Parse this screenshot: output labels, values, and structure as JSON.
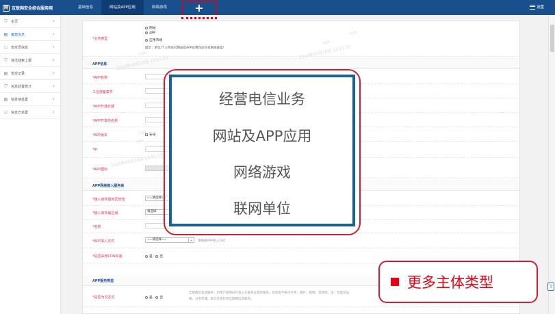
{
  "header": {
    "brand": "互联网安全综合服务网",
    "brand_logo": "网",
    "tabs": [
      {
        "label": "基础信息",
        "active": false
      },
      {
        "label": "网站及APP应用",
        "active": true
      },
      {
        "label": "网络游戏",
        "active": false
      }
    ],
    "plus_label": "+",
    "settings_label": "设置"
  },
  "sidebar": {
    "items": [
      {
        "label": "主页",
        "icon": "shield-icon",
        "glyph": "⛉",
        "active": false
      },
      {
        "label": "备案信息",
        "icon": "document-icon",
        "glyph": "▤",
        "active": true
      },
      {
        "label": "安全员信息",
        "icon": "monitor-icon",
        "glyph": "▭",
        "active": false
      },
      {
        "label": "违法线索上报",
        "icon": "shield-icon",
        "glyph": "⛉",
        "active": false
      },
      {
        "label": "安全记录",
        "icon": "document-icon",
        "glyph": "▤",
        "active": false
      },
      {
        "label": "信息处置统计",
        "icon": "shield-icon",
        "glyph": "⛉",
        "active": false
      },
      {
        "label": "信息待处置",
        "icon": "document-icon",
        "glyph": "▤",
        "active": false
      },
      {
        "label": "信息已处置",
        "icon": "monitor-icon",
        "glyph": "▭",
        "active": false
      }
    ]
  },
  "form": {
    "business_type": {
      "label": "*业务类型",
      "options": [
        "网站",
        "APP",
        "应用市场"
      ],
      "selected": "APP",
      "hint": "提示：单位/个人所有的网站及APP应用均应在本系统备案！"
    },
    "sections": {
      "app_info": "APP信息",
      "network_access": "APP网络接入服务商",
      "app_service": "APP服务类型"
    },
    "fields": {
      "app_name": "*APP名称",
      "icp_no": "工信部备案号",
      "open_date": "*APP开通日期",
      "developer": "*APP开发商名称",
      "version": "*APP版本",
      "version_option": "安卓",
      "ip": "*IP",
      "icon": "*APP图标",
      "provider_region": "*接入商所属地区管辖",
      "provider_region_value": "==请选择==",
      "provider_area": "*接入商所属区域",
      "provider_area_value": "请选择",
      "name": "*名称",
      "access_method": "*APP接入方式",
      "access_method_value": "==请选择==",
      "access_method_hint": "请根据APP接入方式",
      "cdn": "*是否采用CDN加速",
      "cdn_yes": "是",
      "cdn_no": "否",
      "interactive": "*是否为交互式",
      "interactive_yes": "是",
      "interactive_no": "否",
      "interactive_hint_1": "互联网交互式服务：为用户提供向社会公众发布信息的服务，包括但不限于文字、图片、视频、音频等。注：包括论坛、",
      "interactive_hint_2": "格、分享存储、第三方支付等互联网信息服务。"
    },
    "watermarks": [
      "nzh",
      "nzh",
      "2018年09月19日 13:51:33",
      "nzh",
      "nzh",
      "2018年09月19日 13:51:33",
      "nzh",
      "nzh",
      "2018年09月19日 13:51:33"
    ]
  },
  "overlay": {
    "lines": [
      "经营电信业务",
      "网站及APP应用",
      "网络游戏",
      "联网单位"
    ]
  },
  "callout": {
    "text": "更多主体类型"
  },
  "float_button_label": "⇧"
}
